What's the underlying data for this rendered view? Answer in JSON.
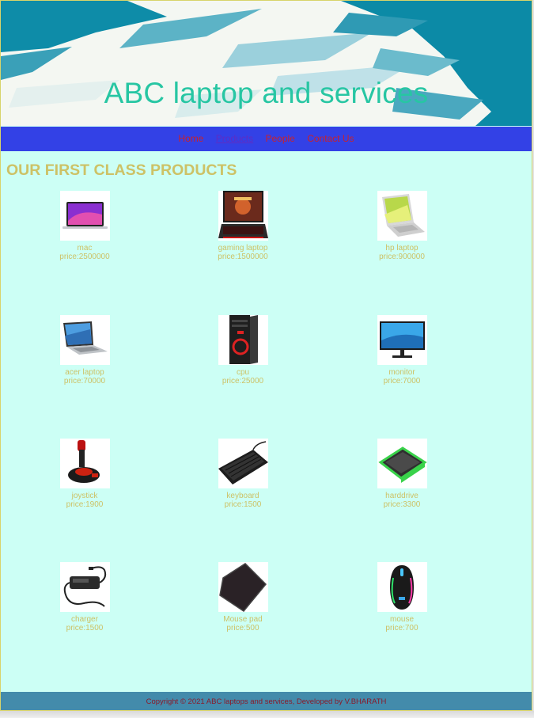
{
  "header": {
    "title": "ABC laptop and services"
  },
  "nav": {
    "items": [
      {
        "label": "Home",
        "active": false
      },
      {
        "label": "Products",
        "active": true
      },
      {
        "label": "People",
        "active": false
      },
      {
        "label": "Contact Us",
        "active": false
      }
    ]
  },
  "main": {
    "heading": "OUR FIRST CLASS PRODUCTS",
    "products": [
      {
        "name": "mac",
        "price": "price:2500000",
        "icon": "laptop-mac-image"
      },
      {
        "name": "gaming laptop",
        "price": "price:1500000",
        "icon": "gaming-laptop-image"
      },
      {
        "name": "hp laptop",
        "price": "price:900000",
        "icon": "hp-laptop-image"
      },
      {
        "name": "acer laptop",
        "price": "price:70000",
        "icon": "acer-laptop-image"
      },
      {
        "name": "cpu",
        "price": "price:25000",
        "icon": "cpu-tower-image"
      },
      {
        "name": "monitor",
        "price": "price:7000",
        "icon": "monitor-image"
      },
      {
        "name": "joystick",
        "price": "price:1900",
        "icon": "joystick-image"
      },
      {
        "name": "keyboard",
        "price": "price:1500",
        "icon": "keyboard-image"
      },
      {
        "name": "harddrive",
        "price": "price:3300",
        "icon": "harddrive-image"
      },
      {
        "name": "charger",
        "price": "price:1500",
        "icon": "charger-image"
      },
      {
        "name": "Mouse pad",
        "price": "price:500",
        "icon": "mouse-pad-image"
      },
      {
        "name": "mouse",
        "price": "price:700",
        "icon": "mouse-image"
      }
    ]
  },
  "footer": {
    "text": "Copyright © 2021 ABC laptops and services, Developed by V.BHARATH"
  },
  "colors": {
    "header_bg": "#0c8aa6",
    "title": "#27c6a3",
    "nav_bg": "#3341e6",
    "nav_link": "#c8222e",
    "page_bg": "#ccfff5",
    "heading": "#cdc266",
    "footer_bg": "#438bab"
  }
}
